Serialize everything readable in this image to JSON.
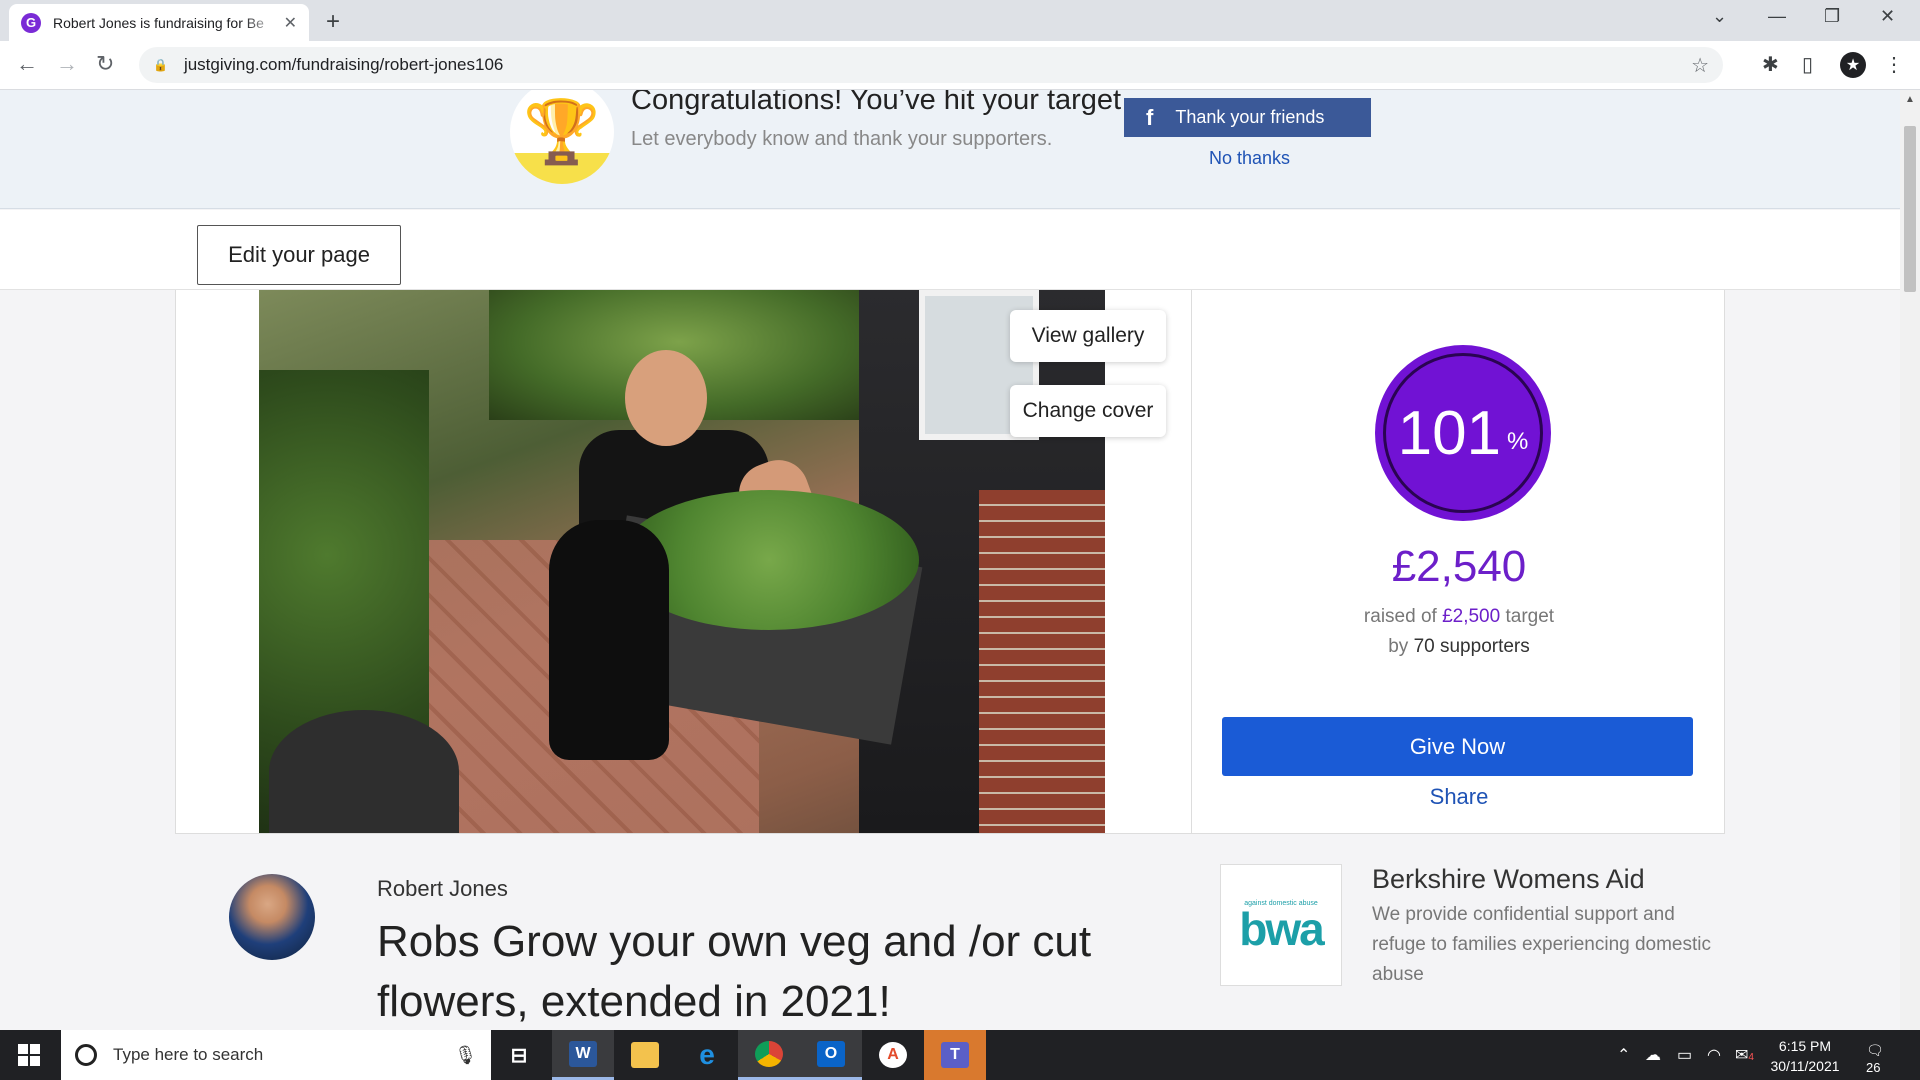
{
  "browser": {
    "tab_title": "Robert Jones is fundraising for Be",
    "favicon_letter": "G",
    "url": "justgiving.com/fundraising/robert-jones106"
  },
  "banner": {
    "heading": "Congratulations! You’ve hit your target",
    "subtext": "Let everybody know and thank your supporters.",
    "fb_button": "Thank your friends",
    "fb_icon_letter": "f",
    "no_thanks": "No thanks"
  },
  "editbar": {
    "edit_button": "Edit your page"
  },
  "hero": {
    "view_gallery": "View gallery",
    "change_cover": "Change cover"
  },
  "stats": {
    "percent": "101",
    "percent_sign": "%",
    "raised": "£2,540",
    "raised_prefix": "raised of",
    "target_amount": "£2,500",
    "target_suffix": "target",
    "by_prefix": "by",
    "supporters": "70 supporters",
    "give_button": "Give Now",
    "share": "Share",
    "accent_color": "#7112d4"
  },
  "fundraiser": {
    "name": "Robert Jones",
    "title": "Robs Grow your own veg and /or cut flowers, extended in 2021!"
  },
  "charity": {
    "logo_small": "against domestic abuse",
    "logo_text": "bwa",
    "name": "Berkshire Womens Aid",
    "description": "We provide confidential support and refuge to families experiencing domestic abuse"
  },
  "taskbar": {
    "search_placeholder": "Type here to search",
    "time": "6:15 PM",
    "date": "30/11/2021",
    "notification_count": "26",
    "mail_badge": "4"
  }
}
